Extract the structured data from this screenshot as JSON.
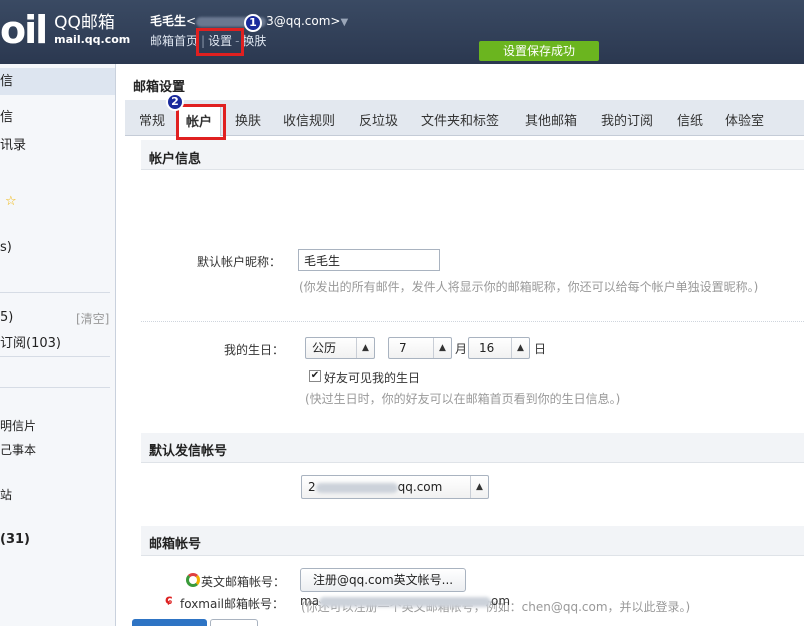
{
  "header": {
    "logo_mark": "oil",
    "logo_title": "QQ邮箱",
    "logo_sub": "mail.qq.com",
    "user_name": "毛毛生",
    "user_email_prefix": "<",
    "user_email_suffix": "3@qq.com>",
    "links": [
      "邮箱首页",
      "设置",
      "换肤"
    ],
    "toast": "设置保存成功",
    "badge1": "1",
    "badge2": "2"
  },
  "sidebar": {
    "items": [
      {
        "label": "信",
        "active": true
      },
      {
        "label": "信"
      },
      {
        "label": "讯录"
      },
      {
        "label": "☆",
        "star": true
      },
      {
        "label": "s)"
      },
      {
        "label": "5)",
        "clear": "[清空]"
      },
      {
        "label": "订阅(103)"
      },
      {
        "label": "明信片"
      },
      {
        "label": "己事本"
      },
      {
        "label": "站"
      },
      {
        "label": "(31)"
      }
    ]
  },
  "main": {
    "title": "邮箱设置",
    "tabs": [
      "常规",
      "帐户",
      "换肤",
      "收信规则",
      "反垃圾",
      "文件夹和标签",
      "其他邮箱",
      "我的订阅",
      "信纸",
      "体验室"
    ],
    "active_tab": "帐户"
  },
  "account": {
    "section_title": "帐户信息",
    "nickname_label": "默认帐户昵称：",
    "nickname_value": "毛毛生",
    "nickname_hint": "(你发出的所有邮件，发件人将显示你的邮箱昵称，你还可以给每个帐户单独设置昵称。)",
    "birthday_label": "我的生日：",
    "calendar_value": "公历",
    "month_value": "7",
    "month_unit": "月",
    "day_value": "16",
    "day_unit": "日",
    "friends_visible_label": "好友可见我的生日",
    "birthday_hint": "(快过生日时，你的好友可以在邮箱首页看到你的生日信息。)"
  },
  "default_sender": {
    "section_title": "默认发信帐号",
    "value_prefix": "2",
    "value_suffix": "qq.com"
  },
  "mailbox_accounts": {
    "section_title": "邮箱帐号",
    "english_label": "英文邮箱帐号：",
    "english_button": "注册@qq.com英文帐号...",
    "english_hint": "(你还可以注册一个英文邮箱帐号，例如：chen@qq.com，并以此登录。)",
    "foxmail_label": "foxmail邮箱帐号：",
    "foxmail_prefix": "ma",
    "foxmail_suffix": "om"
  }
}
